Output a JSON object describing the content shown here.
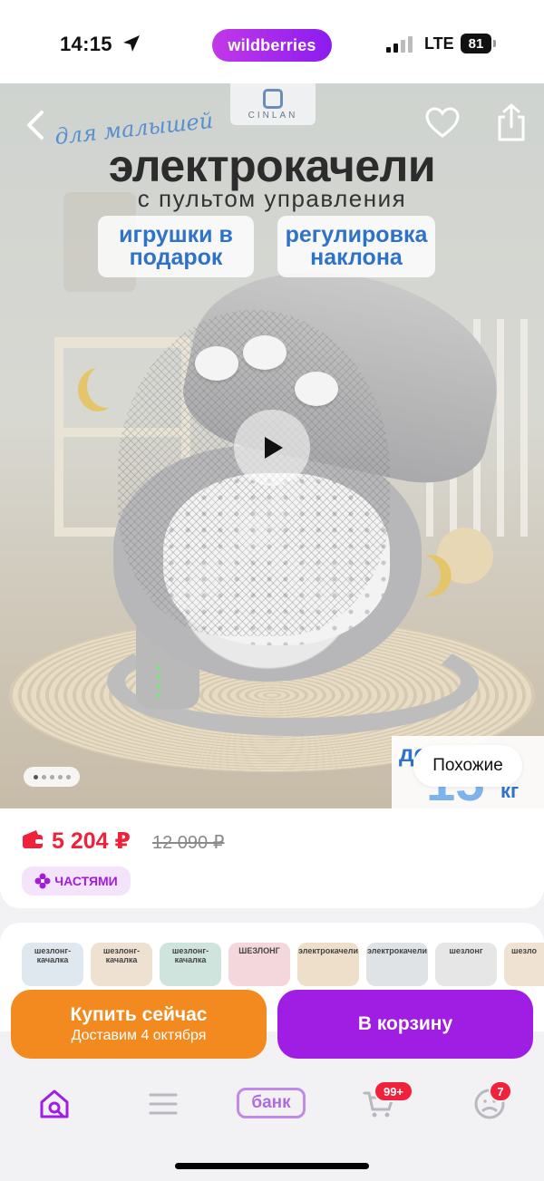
{
  "status_bar": {
    "time": "14:15",
    "location_icon": "location-arrow-icon",
    "brand": "wildberries",
    "network": "LTE",
    "battery": "81",
    "brand_gradient": [
      "#c238e8",
      "#8b1cf0"
    ]
  },
  "hero": {
    "brand_logo_text": "CINLAN",
    "script_tag": "для малышей",
    "headline": "электрокачели",
    "subheadline": "с пультом управления",
    "features": [
      "игрушки в подарок",
      "регулировка наклона"
    ],
    "weight_prefix": "до",
    "weight_number": "15",
    "weight_unit": "кг",
    "gallery_count": 5,
    "gallery_active_index": 0,
    "similar_button": "Похожие",
    "icons": [
      "back-chevron-icon",
      "heart-icon",
      "share-icon",
      "play-icon"
    ]
  },
  "price": {
    "current": "5 204 ₽",
    "old": "12 090 ₽",
    "installments_label": "ЧАСТЯМИ",
    "accent_color": "#f0213a",
    "installments_color": "#a21cdb"
  },
  "thumbnails": [
    {
      "label": "шезлонг-качалка",
      "color": "#dfe8ee"
    },
    {
      "label": "шезлонг-качалка",
      "color": "#efe1d1"
    },
    {
      "label": "шезлонг-качалка",
      "color": "#cfe4dd"
    },
    {
      "label": "ШЕЗЛОНГ",
      "color": "#f3d7dc"
    },
    {
      "label": "электрокачели",
      "color": "#eedfca"
    },
    {
      "label": "электрокачели",
      "color": "#dfe3e6"
    },
    {
      "label": "шезлонг",
      "color": "#e6e6e6"
    },
    {
      "label": "шезло",
      "color": "#f0e2d3"
    }
  ],
  "actions": {
    "buy_now": "Купить сейчас",
    "delivery": "Доставим 4 октября",
    "add_to_cart": "В корзину",
    "buy_color": "#f28a1f",
    "cart_color": "#a01de3"
  },
  "bottom_nav": {
    "items": [
      "home-search-icon",
      "menu-icon",
      "bank-icon",
      "cart-icon",
      "profile-icon"
    ],
    "bank_label": "банк",
    "cart_badge": "99+",
    "profile_badge": "7"
  }
}
